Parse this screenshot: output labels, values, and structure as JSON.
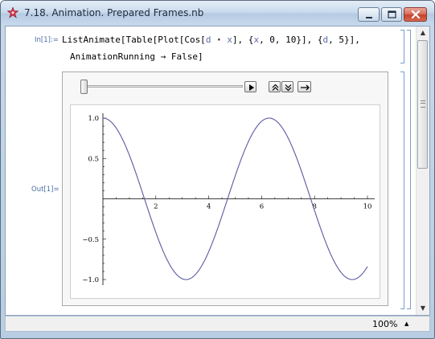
{
  "window": {
    "title": "7.18. Animation. Prepared Frames.nb"
  },
  "notebook": {
    "input_label": "In[1]:=",
    "output_label": "Out[1]=",
    "input_code_line1": {
      "p1": "ListAnimate[Table[Plot[Cos[",
      "v1": "d",
      "p2": " ⋆ ",
      "v2": "x",
      "p3": "], {",
      "v3": "x",
      "p4": ", 0, 10}], {",
      "v4": "d",
      "p5": ", 5}],"
    },
    "input_code_line2": "AnimationRunning → False]"
  },
  "animation": {
    "controls": [
      "slider",
      "play",
      "faster",
      "slower",
      "direction"
    ],
    "slider_position": 0
  },
  "chart_data": {
    "type": "line",
    "function": "cos(x)",
    "x": [
      0,
      0.5,
      1,
      1.5,
      2,
      2.5,
      3,
      3.5,
      4,
      4.5,
      5,
      5.5,
      6,
      6.5,
      7,
      7.5,
      8,
      8.5,
      9,
      9.5,
      10
    ],
    "y": [
      1.0,
      0.878,
      0.54,
      0.071,
      -0.416,
      -0.801,
      -0.99,
      -0.936,
      -0.654,
      -0.211,
      0.284,
      0.709,
      0.96,
      0.977,
      0.754,
      0.347,
      -0.146,
      -0.602,
      -0.911,
      -0.997,
      -0.839
    ],
    "xlim": [
      0,
      10
    ],
    "ylim": [
      -1.0,
      1.0
    ],
    "x_ticks": [
      "2",
      "4",
      "6",
      "8",
      "10"
    ],
    "y_ticks": [
      "1.0",
      "0.5",
      "−0.5",
      "−1.0"
    ],
    "line_color": "#5a5aa0",
    "grid": false
  },
  "statusbar": {
    "zoom": "100%"
  }
}
